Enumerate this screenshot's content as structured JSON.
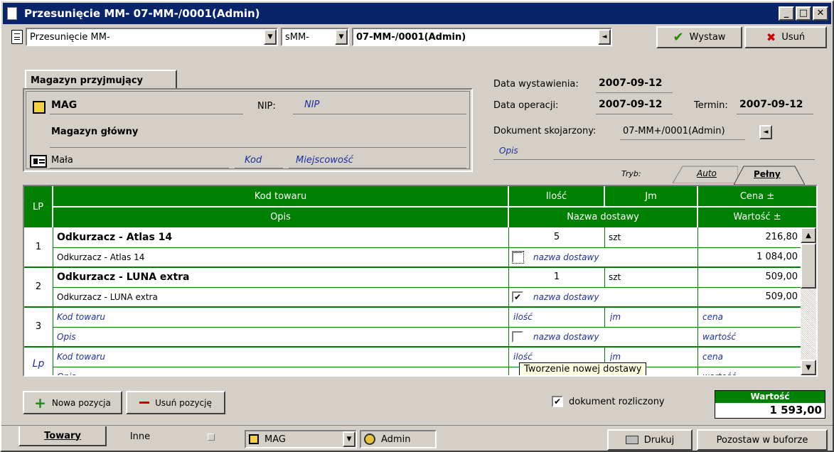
{
  "window": {
    "title": "Przesunięcie MM- 07-MM-/0001(Admin)",
    "minimize_glyph": "_",
    "maximize_glyph": "□",
    "close_glyph": "✕"
  },
  "toolbar": {
    "doc_type": "Przesunięcie MM-",
    "series": "sMM-",
    "doc_number": "07-MM-/0001(Admin)",
    "issue_label": "Wystaw",
    "delete_label": "Usuń"
  },
  "warehouse": {
    "tab_label": "Magazyn przyjmujący",
    "code": "MAG",
    "nip_label": "NIP:",
    "nip_placeholder": "NIP",
    "name": "Magazyn główny",
    "street": "Mała",
    "postcode_placeholder": "Kod",
    "city_placeholder": "Miejscowość"
  },
  "dates": {
    "issue_label": "Data wystawienia:",
    "issue_value": "2007-09-12",
    "operation_label": "Data operacji:",
    "operation_value": "2007-09-12",
    "term_label": "Termin:",
    "term_value": "2007-09-12",
    "related_label": "Dokument skojarzony:",
    "related_value": "07-MM+/0001(Admin)",
    "description_placeholder": "Opis"
  },
  "mode": {
    "label": "Tryb:",
    "tabs": [
      "Auto",
      "Pełny"
    ],
    "active": "Pełny"
  },
  "grid": {
    "headers": {
      "lp": "LP",
      "code": "Kod towaru",
      "qty": "Ilość",
      "unit": "Jm",
      "price": "Cena ±",
      "desc": "Opis",
      "delivery": "Nazwa dostawy",
      "value": "Wartość ±"
    },
    "rows": [
      {
        "lp": "1",
        "code": "Odkurzacz - Atlas 14",
        "desc": "Odkurzacz - Atlas 14",
        "qty": "5",
        "unit": "szt",
        "delivery": "nazwa dostawy",
        "checked": false,
        "price": "216,80",
        "value": "1 084,00"
      },
      {
        "lp": "2",
        "code": "Odkurzacz - LUNA extra",
        "desc": "Odkurzacz - LUNA extra",
        "qty": "1",
        "unit": "szt",
        "delivery": "nazwa dostawy",
        "checked": true,
        "price": "509,00",
        "value": "509,00"
      },
      {
        "lp": "3",
        "code": "Kod towaru",
        "desc": "Opis",
        "qty": "ilość",
        "unit": "jm",
        "delivery": "nazwa dostawy",
        "checked": false,
        "price": "cena",
        "value": "wartość"
      },
      {
        "lp": "Lp",
        "code": "Kod towaru",
        "desc": "Opis",
        "qty": "ilość",
        "unit": "jm",
        "delivery": "",
        "checked": false,
        "price": "cena",
        "value": "wartość"
      }
    ],
    "tooltip": "Tworzenie nowej dostawy",
    "check_glyph": "✔"
  },
  "bottom": {
    "add_position": "Nowa pozycja",
    "remove_position": "Usuń pozycję",
    "settled_label": "dokument rozliczony",
    "settled_checked": true,
    "total_label": "Wartość",
    "total_value": "1 593,00"
  },
  "footer": {
    "tabs": [
      "Towary",
      "Inne"
    ],
    "warehouse": "MAG",
    "user": "Admin",
    "print_label": "Drukuj",
    "buffer_label": "Pozostaw w buforze"
  },
  "colors": {
    "titlebar": "#0a246a",
    "grid_header": "#008000",
    "placeholder_blue": "#1f2fa0"
  }
}
